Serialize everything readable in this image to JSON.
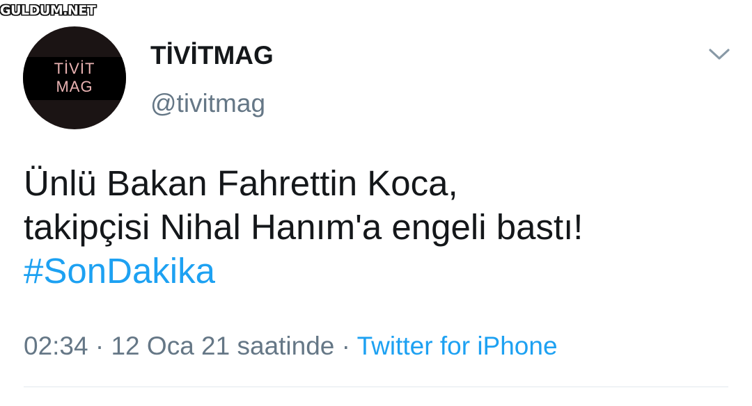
{
  "watermark": "GULDUM.NET",
  "tweet": {
    "author": {
      "avatar_text_line1": "TİVİT",
      "avatar_text_line2": "MAG",
      "display_name": "TİVİTMAG",
      "handle": "@tivitmag"
    },
    "menu_icon": "chevron-down-icon",
    "text_line1": "Ünlü Bakan Fahrettin Koca,",
    "text_line2": "takipçisi Nihal Hanım'a engeli bastı!",
    "hashtag": "#SonDakika",
    "time": "02:34",
    "separator": "·",
    "date": "12 Oca 21 saatinde",
    "source": "Twitter for iPhone"
  },
  "colors": {
    "text_primary": "#14171a",
    "text_secondary": "#657786",
    "link": "#1da1f2",
    "divider": "#e1e8ed"
  }
}
